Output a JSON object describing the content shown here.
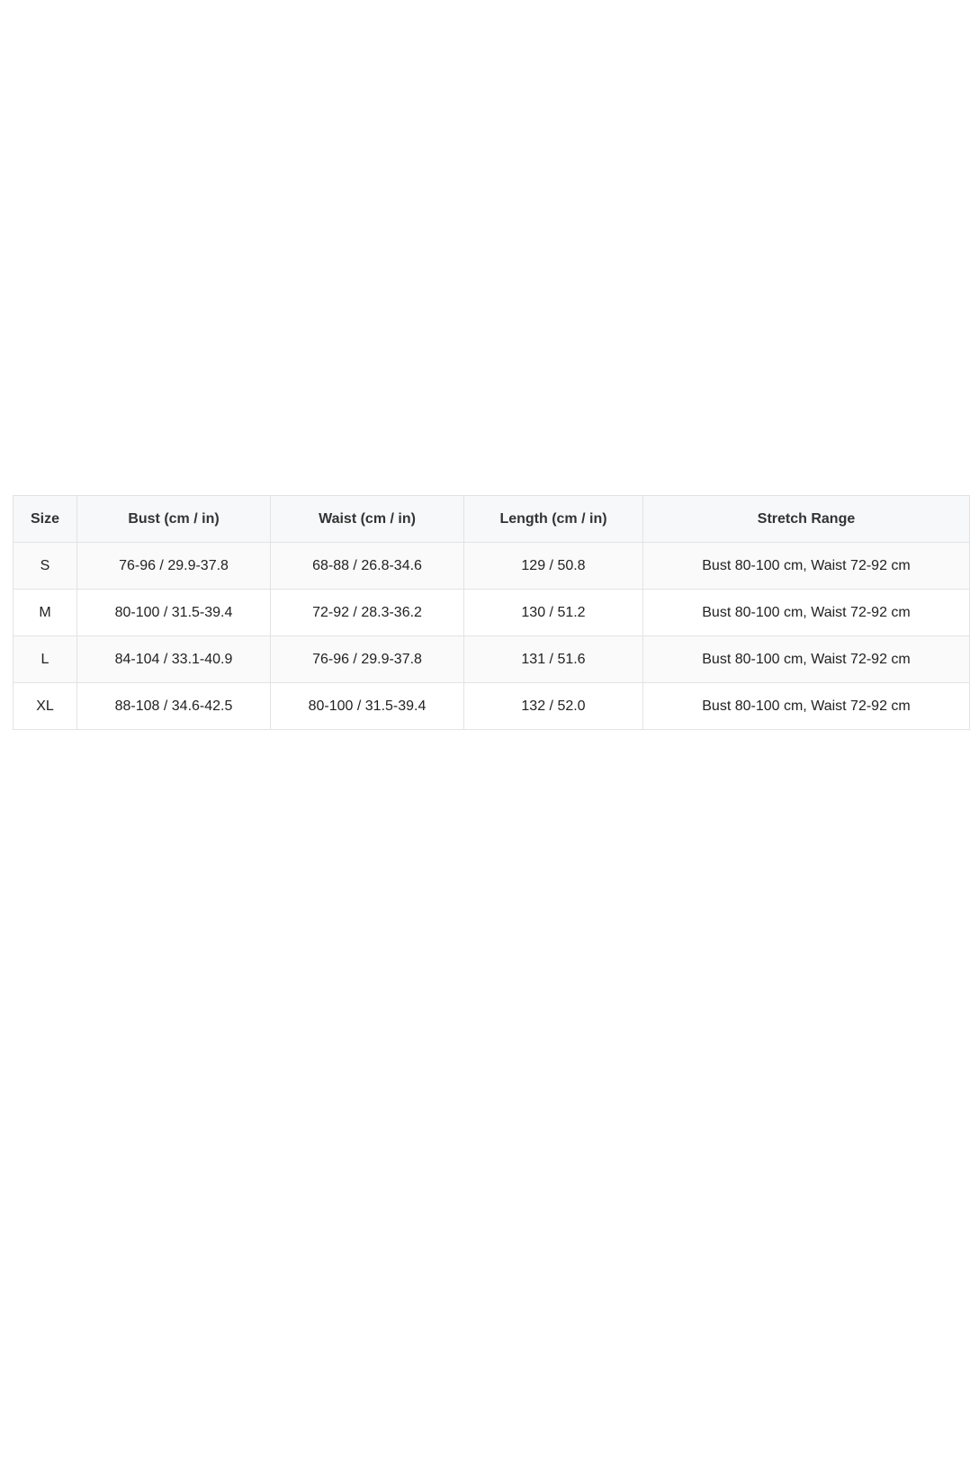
{
  "size_table": {
    "headers": [
      "Size",
      "Bust (cm / in)",
      "Waist (cm / in)",
      "Length (cm / in)",
      "Stretch Range"
    ],
    "rows": [
      [
        "S",
        "76-96 / 29.9-37.8",
        "68-88 / 26.8-34.6",
        "129 / 50.8",
        "Bust 80-100 cm, Waist 72-92 cm"
      ],
      [
        "M",
        "80-100 / 31.5-39.4",
        "72-92 / 28.3-36.2",
        "130 / 51.2",
        "Bust 80-100 cm, Waist 72-92 cm"
      ],
      [
        "L",
        "84-104 / 33.1-40.9",
        "76-96 / 29.9-37.8",
        "131 / 51.6",
        "Bust 80-100 cm, Waist 72-92 cm"
      ],
      [
        "XL",
        "88-108 / 34.6-42.5",
        "80-100 / 31.5-39.4",
        "132 / 52.0",
        "Bust 80-100 cm, Waist 72-92 cm"
      ]
    ]
  },
  "colors": {
    "border": "#e3e3e3",
    "header_bg": "#f7f8f9",
    "text": "#222222"
  }
}
